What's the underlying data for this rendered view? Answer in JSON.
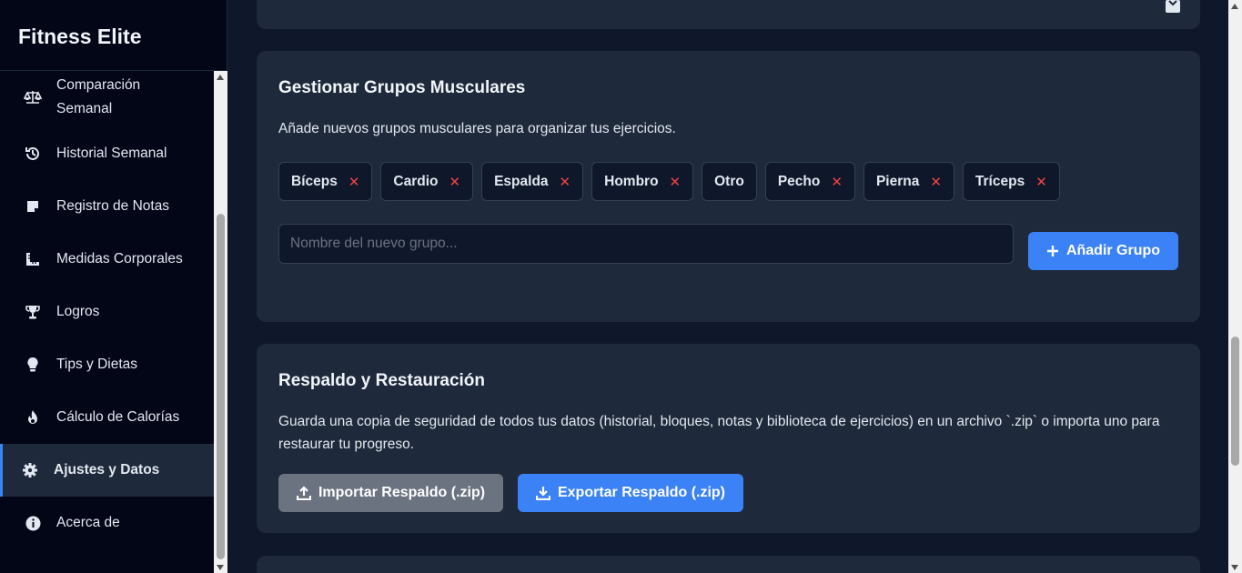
{
  "sidebar": {
    "brand": "Fitness Elite",
    "items": [
      {
        "label": "Comparación Semanal",
        "icon": "balance-scale-icon"
      },
      {
        "label": "Historial Semanal",
        "icon": "history-icon"
      },
      {
        "label": "Registro de Notas",
        "icon": "sticky-note-icon"
      },
      {
        "label": "Medidas Corporales",
        "icon": "ruler-icon"
      },
      {
        "label": "Logros",
        "icon": "trophy-icon"
      },
      {
        "label": "Tips y Dietas",
        "icon": "lightbulb-icon"
      },
      {
        "label": "Cálculo de Calorías",
        "icon": "fire-icon"
      },
      {
        "label": "Ajustes y Datos",
        "icon": "gear-icon",
        "active": true
      },
      {
        "label": "Acerca de",
        "icon": "info-icon"
      }
    ]
  },
  "muscle_groups": {
    "title": "Gestionar Grupos Musculares",
    "description": "Añade nuevos grupos musculares para organizar tus ejercicios.",
    "tags": [
      "Bíceps",
      "Cardio",
      "Espalda",
      "Hombro",
      "Otro",
      "Pecho",
      "Pierna",
      "Tríceps"
    ],
    "removable": [
      true,
      true,
      true,
      true,
      false,
      true,
      true,
      true
    ],
    "input_placeholder": "Nombre del nuevo grupo...",
    "input_value": "",
    "add_button": "Añadir Grupo"
  },
  "backup": {
    "title": "Respaldo y Restauración",
    "description": "Guarda una copia de seguridad de todos tus datos (historial, bloques, notas y biblioteca de ejercicios) en un archivo `.zip` o importa uno para restaurar tu progreso.",
    "import_button": "Importar Respaldo (.zip)",
    "export_button": "Exportar Respaldo (.zip)"
  },
  "colors": {
    "accent": "#3b82f6",
    "danger": "#ef4444",
    "card_bg": "#1e293b",
    "page_bg": "#0f172a",
    "sidebar_bg": "#020617"
  }
}
